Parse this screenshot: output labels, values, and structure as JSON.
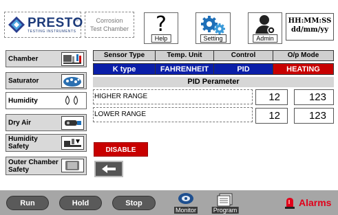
{
  "header": {
    "logo_text": "PRESTO",
    "logo_subtext": "TESTING INSTRUMENTS",
    "logo_reg": "®",
    "chamber_line1": "Corrosion",
    "chamber_line2": "Test Chamber",
    "help_symbol": "?",
    "help_label": "Help",
    "setting_label": "Setting",
    "admin_label": "Admin",
    "time_format": "HH:MM:SS",
    "date_format": "dd/mm/yy"
  },
  "sidebar": {
    "items": [
      {
        "label": "Chamber",
        "icon": "chamber-icon"
      },
      {
        "label": "Saturator",
        "icon": "saturator-icon"
      },
      {
        "label": "Humidity",
        "icon": "humidity-icon"
      },
      {
        "label": "Dry Air",
        "icon": "dry-air-icon"
      },
      {
        "label": "Humidity Safety",
        "icon": "humidity-safety-icon"
      },
      {
        "label": "Outer Chamber Safety",
        "icon": "outer-chamber-icon"
      }
    ],
    "active_index": 2
  },
  "table": {
    "headers": [
      "Sensor Type",
      "Temp. Unit",
      "Control",
      "O/p Mode"
    ],
    "values": [
      "K type",
      "FAHRENHEIT",
      "PID",
      "HEATING"
    ]
  },
  "pid": {
    "title": "PID Perameter",
    "rows": [
      {
        "label": "HIGHER RANGE",
        "value1": "12",
        "value2": "123"
      },
      {
        "label": "LOWER RANGE",
        "value1": "12",
        "value2": "123"
      }
    ]
  },
  "actions": {
    "disable_label": "DISABLE",
    "back_icon": "back-arrow-icon"
  },
  "footer": {
    "run_label": "Run",
    "hold_label": "Hold",
    "stop_label": "Stop",
    "monitor_label": "Monitor",
    "program_label": "Program",
    "alarms_label": "Alarms"
  },
  "colors": {
    "value_blue": "#0a1ea8",
    "heating_red": "#c80000",
    "disable_red": "#c80000",
    "alarm_red": "#e0001a",
    "footer_gray": "#a6a6a6"
  }
}
